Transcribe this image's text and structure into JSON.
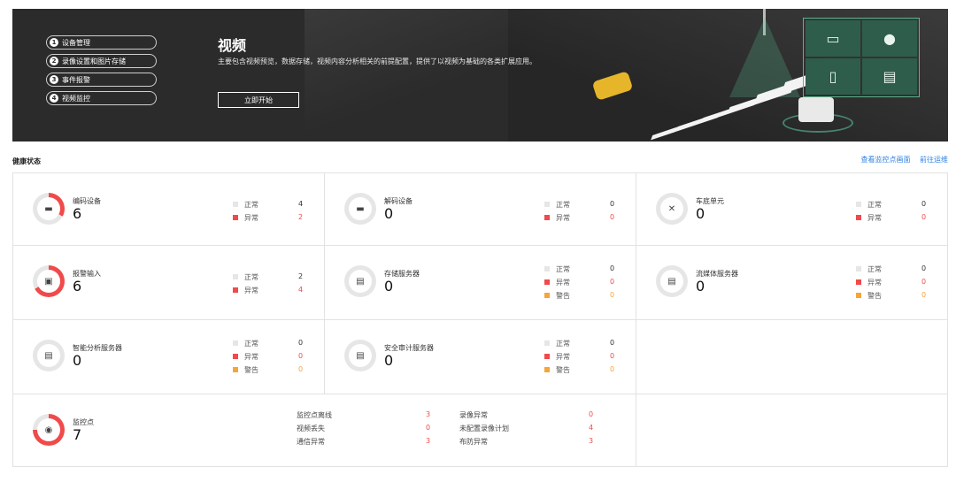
{
  "banner": {
    "steps": [
      {
        "num": "1",
        "label": "设备管理"
      },
      {
        "num": "2",
        "label": "录像设置和图片存储"
      },
      {
        "num": "3",
        "label": "事件报警"
      },
      {
        "num": "4",
        "label": "视频监控"
      }
    ],
    "title": "视频",
    "description": "主要包含视频预览，数据存储，视频内容分析相关的前提配置，提供了以视频为基础的各类扩展应用。",
    "start_button": "立即开始"
  },
  "health": {
    "title": "健康状态",
    "links": [
      "查看监控点画面",
      "前往运维"
    ]
  },
  "legend_labels": {
    "normal": "正常",
    "abnormal": "异常",
    "warning": "警告"
  },
  "colors": {
    "normal": "#e6e6e6",
    "abnormal": "#f04a4a",
    "warning": "#f5a53a",
    "accent": "#2f7fe0"
  },
  "cards": [
    {
      "name": "编码设备",
      "total": "6",
      "icon": "encoder-icon",
      "normal": "4",
      "abnormal": "2"
    },
    {
      "name": "解码设备",
      "total": "0",
      "icon": "decoder-icon",
      "normal": "0",
      "abnormal": "0"
    },
    {
      "name": "车底单元",
      "total": "0",
      "icon": "under-vehicle-icon",
      "normal": "0",
      "abnormal": "0"
    },
    {
      "name": "报警输入",
      "total": "6",
      "icon": "alarm-input-icon",
      "normal": "2",
      "abnormal": "4"
    },
    {
      "name": "存储服务器",
      "total": "0",
      "icon": "storage-server-icon",
      "normal": "0",
      "abnormal": "0",
      "warning": "0"
    },
    {
      "name": "流媒体服务器",
      "total": "0",
      "icon": "stream-server-icon",
      "normal": "0",
      "abnormal": "0",
      "warning": "0"
    },
    {
      "name": "智能分析服务器",
      "total": "0",
      "icon": "analysis-server-icon",
      "normal": "0",
      "abnormal": "0",
      "warning": "0"
    },
    {
      "name": "安全审计服务器",
      "total": "0",
      "icon": "audit-server-icon",
      "normal": "0",
      "abnormal": "0",
      "warning": "0"
    }
  ],
  "monitor_point": {
    "name": "监控点",
    "total": "7",
    "items": [
      {
        "label": "监控点离线",
        "value": "3"
      },
      {
        "label": "视频丢失",
        "value": "0"
      },
      {
        "label": "通信异常",
        "value": "3"
      },
      {
        "label": "录像异常",
        "value": "0"
      },
      {
        "label": "未配置录像计划",
        "value": "4"
      },
      {
        "label": "布防异常",
        "value": "3"
      }
    ]
  }
}
